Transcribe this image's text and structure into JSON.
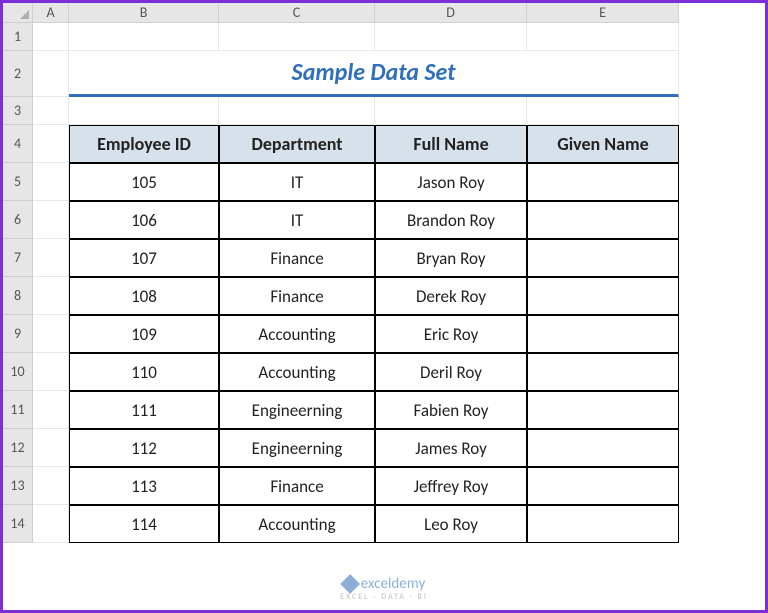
{
  "columns": [
    "A",
    "B",
    "C",
    "D",
    "E"
  ],
  "row_numbers": [
    "1",
    "2",
    "3",
    "4",
    "5",
    "6",
    "7",
    "8",
    "9",
    "10",
    "11",
    "12",
    "13",
    "14"
  ],
  "title": "Sample Data Set",
  "headers": {
    "employee_id": "Employee ID",
    "department": "Department",
    "full_name": "Full Name",
    "given_name": "Given Name"
  },
  "chart_data": {
    "type": "table",
    "columns": [
      "Employee ID",
      "Department",
      "Full Name",
      "Given Name"
    ],
    "rows": [
      {
        "employee_id": "105",
        "department": "IT",
        "full_name": "Jason Roy",
        "given_name": ""
      },
      {
        "employee_id": "106",
        "department": "IT",
        "full_name": "Brandon Roy",
        "given_name": ""
      },
      {
        "employee_id": "107",
        "department": "Finance",
        "full_name": "Bryan Roy",
        "given_name": ""
      },
      {
        "employee_id": "108",
        "department": "Finance",
        "full_name": "Derek Roy",
        "given_name": ""
      },
      {
        "employee_id": "109",
        "department": "Accounting",
        "full_name": "Eric Roy",
        "given_name": ""
      },
      {
        "employee_id": "110",
        "department": "Accounting",
        "full_name": "Deril Roy",
        "given_name": ""
      },
      {
        "employee_id": "111",
        "department": "Engineerning",
        "full_name": "Fabien Roy",
        "given_name": ""
      },
      {
        "employee_id": "112",
        "department": "Engineerning",
        "full_name": "James Roy",
        "given_name": ""
      },
      {
        "employee_id": "113",
        "department": "Finance",
        "full_name": "Jeffrey Roy",
        "given_name": ""
      },
      {
        "employee_id": "114",
        "department": "Accounting",
        "full_name": "Leo Roy",
        "given_name": ""
      }
    ]
  },
  "watermark": {
    "name": "exceldemy",
    "sub": "EXCEL · DATA · BI"
  }
}
